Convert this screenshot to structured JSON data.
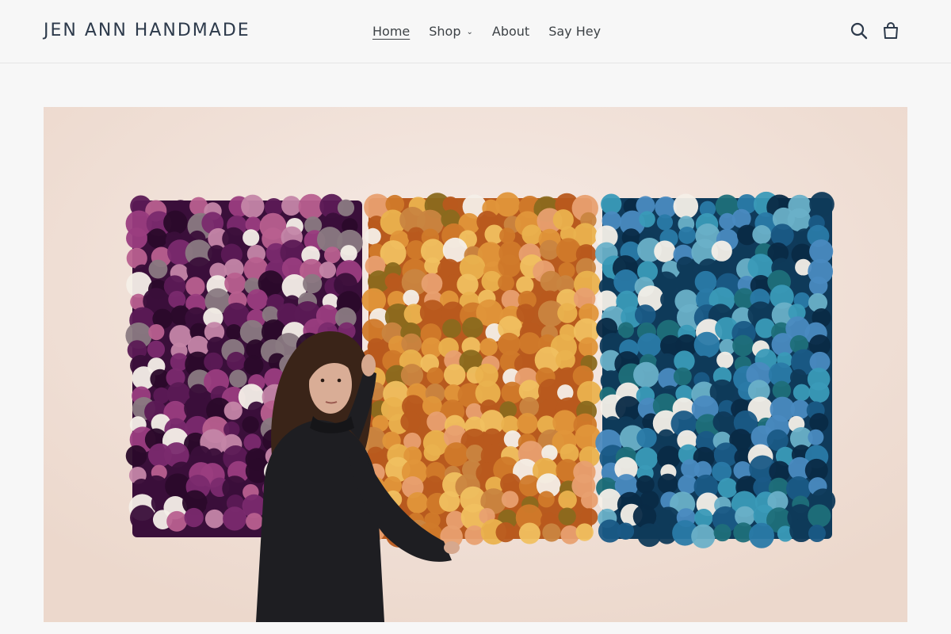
{
  "header": {
    "logo": "JEN ANN HANDMADE",
    "nav": [
      {
        "label": "Home",
        "active": true
      },
      {
        "label": "Shop",
        "dropdown": true
      },
      {
        "label": "About"
      },
      {
        "label": "Say Hey"
      }
    ],
    "icons": {
      "search": "search-icon",
      "cart": "cart-icon"
    }
  },
  "hero": {
    "alt_subject": "artist standing in front of three pom-pom wall hangings",
    "panel_palettes": {
      "left": [
        "#3a0f3a",
        "#5b1a55",
        "#7a2a6e",
        "#9a3d80",
        "#b8608f",
        "#8a7a82",
        "#2a0a2a",
        "#c486a8"
      ],
      "middle": [
        "#b85a1e",
        "#d07a2a",
        "#e0963a",
        "#eab24e",
        "#c98540",
        "#8a6a1e",
        "#e8a070",
        "#f0c060"
      ],
      "right": [
        "#0f3a5a",
        "#1a5a86",
        "#2a7aa8",
        "#3a9ab8",
        "#1f6f7a",
        "#4a8ac0",
        "#0a2a46",
        "#6ab0c8"
      ]
    }
  }
}
